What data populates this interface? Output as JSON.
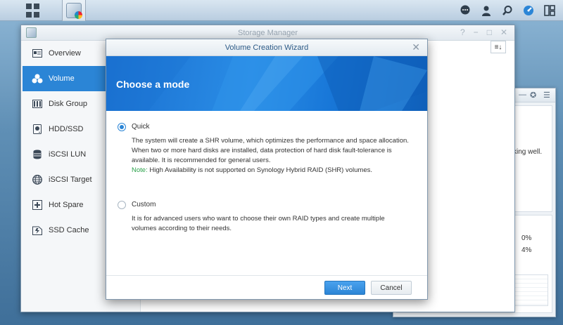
{
  "taskbar": {
    "main_menu_icon": "main-menu-icon",
    "app_icon": "storage-manager-icon",
    "right_icons": [
      "chat-icon",
      "user-icon",
      "search-icon",
      "dashboard-icon",
      "widgets-icon"
    ]
  },
  "window": {
    "title": "Storage Manager",
    "controls": [
      "?",
      "−",
      "□",
      "✕"
    ]
  },
  "sidebar": {
    "items": [
      {
        "label": "Overview",
        "icon": "overview-icon",
        "active": false
      },
      {
        "label": "Volume",
        "icon": "volume-icon",
        "active": true
      },
      {
        "label": "Disk Group",
        "icon": "disk-group-icon",
        "active": false
      },
      {
        "label": "HDD/SSD",
        "icon": "hdd-icon",
        "active": false
      },
      {
        "label": "iSCSI LUN",
        "icon": "iscsi-lun-icon",
        "active": false
      },
      {
        "label": "iSCSI Target",
        "icon": "globe-icon",
        "active": false
      },
      {
        "label": "Hot Spare",
        "icon": "hot-spare-icon",
        "active": false
      },
      {
        "label": "SSD Cache",
        "icon": "ssd-cache-icon",
        "active": false
      }
    ]
  },
  "widget": {
    "partial_text": "king well.",
    "percent_1": "0%",
    "percent_2": "4%"
  },
  "wizard": {
    "title": "Volume Creation Wizard",
    "heading": "Choose a mode",
    "options": [
      {
        "label": "Quick",
        "checked": true,
        "desc_1": "The system will create a SHR volume, which optimizes the performance and space allocation.",
        "desc_2": "When two or more hard disks are installed, data protection of hard disk fault-tolerance is",
        "desc_3": "available. It is recommended for general users.",
        "note_label": "Note:",
        "note_text": " High Availability is not supported on Synology Hybrid RAID (SHR) volumes."
      },
      {
        "label": "Custom",
        "checked": false,
        "desc_1": "It is for advanced users who want to choose their own RAID types and create multiple",
        "desc_2": "volumes according to their needs."
      }
    ],
    "next_label": "Next",
    "cancel_label": "Cancel"
  },
  "colors": {
    "accent": "#2b85d6",
    "note": "#2aa14a",
    "banner": "#1a6fd0"
  }
}
